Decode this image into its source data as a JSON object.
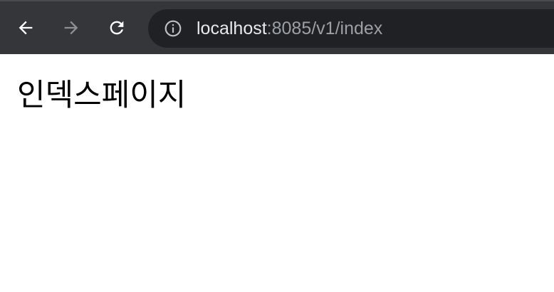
{
  "browser": {
    "url_host": "localhost",
    "url_rest": ":8085/v1/index",
    "icons": {
      "back": "arrow-left-icon",
      "forward": "arrow-right-icon",
      "reload": "reload-icon",
      "info": "info-icon"
    },
    "colors": {
      "toolbar_bg": "#35363a",
      "omnibox_bg": "#202124",
      "url_host_text": "#e8eaed",
      "url_rest_text": "#9aa0a6"
    }
  },
  "page": {
    "heading": "인덱스페이지"
  }
}
